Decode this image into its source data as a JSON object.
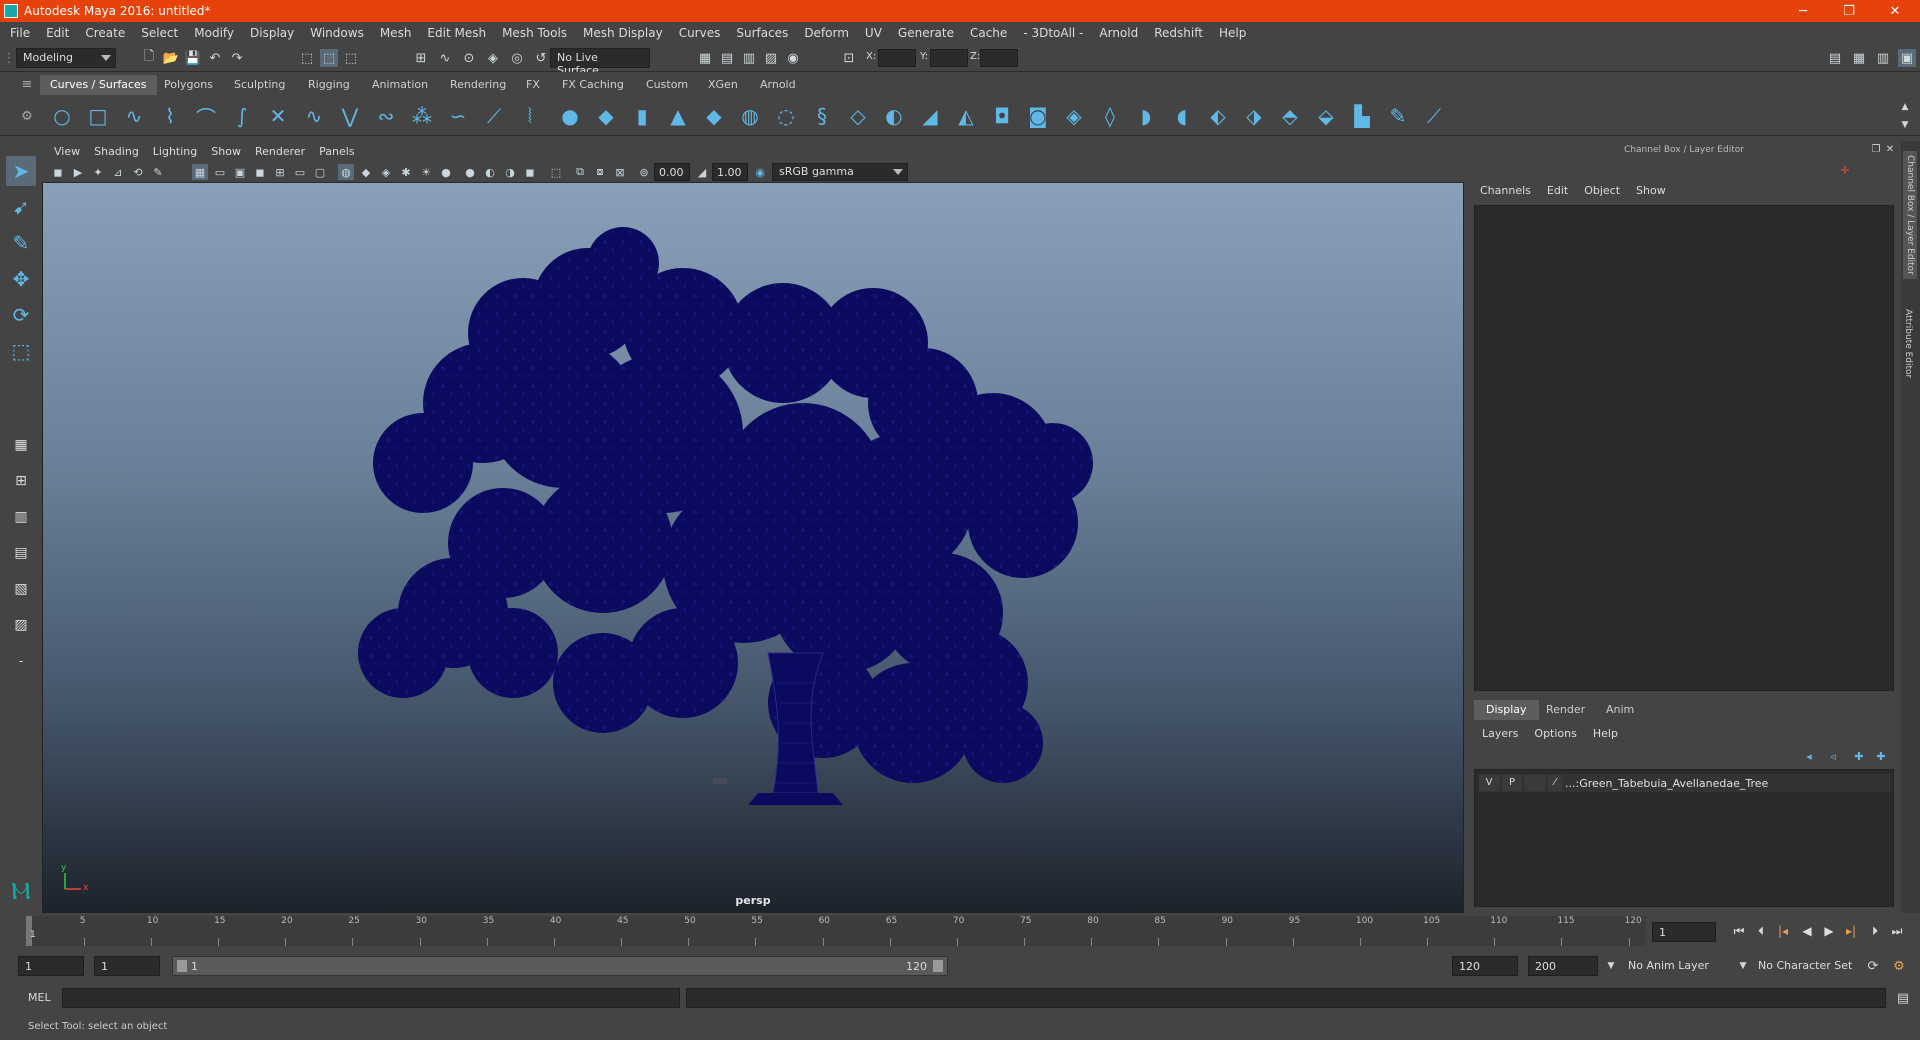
{
  "window": {
    "title": "Autodesk Maya 2016: untitled*",
    "controls": [
      "─",
      "❐",
      "✕"
    ]
  },
  "menubar": [
    "File",
    "Edit",
    "Create",
    "Select",
    "Modify",
    "Display",
    "Windows",
    "Mesh",
    "Edit Mesh",
    "Mesh Tools",
    "Mesh Display",
    "Curves",
    "Surfaces",
    "Deform",
    "UV",
    "Generate",
    "Cache",
    "- 3DtoAll -",
    "Arnold",
    "Redshift",
    "Help"
  ],
  "statusline": {
    "menuset": "Modeling",
    "live_surface": "No Live Surface",
    "x_label": "X:",
    "y_label": "Y:",
    "z_label": "Z:"
  },
  "shelf": {
    "tabs": [
      "Curves / Surfaces",
      "Polygons",
      "Sculpting",
      "Rigging",
      "Animation",
      "Rendering",
      "FX",
      "FX Caching",
      "Custom",
      "XGen",
      "Arnold"
    ],
    "active_tab": "Curves / Surfaces"
  },
  "viewport": {
    "menu": [
      "View",
      "Shading",
      "Lighting",
      "Show",
      "Renderer",
      "Panels"
    ],
    "exposure": "0.00",
    "gamma": "1.00",
    "color_space": "sRGB gamma",
    "camera": "persp",
    "axis_y": "y",
    "axis_x": "x"
  },
  "channel_box": {
    "title": "Channel Box / Layer Editor",
    "menu": [
      "Channels",
      "Edit",
      "Object",
      "Show"
    ]
  },
  "layer_editor": {
    "tabs": [
      "Display",
      "Render",
      "Anim"
    ],
    "active_tab": "Display",
    "menu": [
      "Layers",
      "Options",
      "Help"
    ],
    "layer": {
      "v": "V",
      "p": "P",
      "name": "...:Green_Tabebuia_Avellanedae_Tree"
    }
  },
  "side_tabs": [
    "Channel Box / Layer Editor",
    "Attribute Editor"
  ],
  "timeslider": {
    "ticks": [
      "5",
      "10",
      "15",
      "20",
      "25",
      "30",
      "35",
      "40",
      "45",
      "50",
      "55",
      "60",
      "65",
      "70",
      "75",
      "80",
      "85",
      "90",
      "95",
      "100",
      "105",
      "110",
      "115",
      "120"
    ],
    "first_tick": "1",
    "current_frame": "1"
  },
  "rangeslider": {
    "start_frame": "1",
    "range_start": "1",
    "slider_start": "1",
    "slider_end": "120",
    "range_end": "120",
    "end_frame": "200",
    "anim_layer": "No Anim Layer",
    "character_set": "No Character Set"
  },
  "cmdline": {
    "label": "MEL"
  },
  "helpline": {
    "text": "Select Tool: select an object"
  },
  "colors": {
    "titlebar": "#e8420c",
    "tree": "#0a0a5e",
    "accent": "#5fb8e6"
  }
}
